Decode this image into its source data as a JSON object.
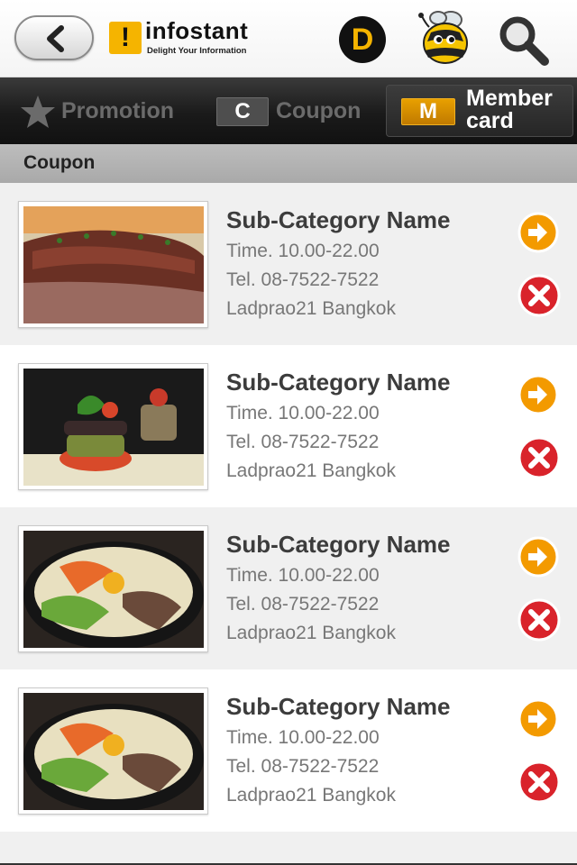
{
  "header": {
    "logo_mark": "!",
    "logo_name": "infostant",
    "logo_tagline": "Delight Your Information",
    "d_icon_label": "D",
    "icons": [
      "back-arrow-icon",
      "d-icon",
      "bee-icon",
      "search-icon"
    ]
  },
  "tabs": [
    {
      "label": "Promotion",
      "icon": "star-icon",
      "active": false
    },
    {
      "label": "Coupon",
      "badge": "C",
      "active": false
    },
    {
      "label": "Member card",
      "badge": "M",
      "active": true
    }
  ],
  "section": {
    "title": "Coupon"
  },
  "items": [
    {
      "title": "Sub-Category Name",
      "time": "Time. 10.00-22.00",
      "tel": "Tel. 08-7522-7522",
      "location": "Ladprao21 Bangkok",
      "image": "grilled-meat"
    },
    {
      "title": "Sub-Category Name",
      "time": "Time. 10.00-22.00",
      "tel": "Tel. 08-7522-7522",
      "location": "Ladprao21 Bangkok",
      "image": "stacked-vegetables"
    },
    {
      "title": "Sub-Category Name",
      "time": "Time. 10.00-22.00",
      "tel": "Tel. 08-7522-7522",
      "location": "Ladprao21 Bangkok",
      "image": "bibimbap-bowl"
    },
    {
      "title": "Sub-Category Name",
      "time": "Time. 10.00-22.00",
      "tel": "Tel. 08-7522-7522",
      "location": "Ladprao21 Bangkok",
      "image": "bibimbap-bowl"
    }
  ],
  "colors": {
    "accent": "#f5b400",
    "go": "#f39a00",
    "delete": "#d9232b"
  }
}
